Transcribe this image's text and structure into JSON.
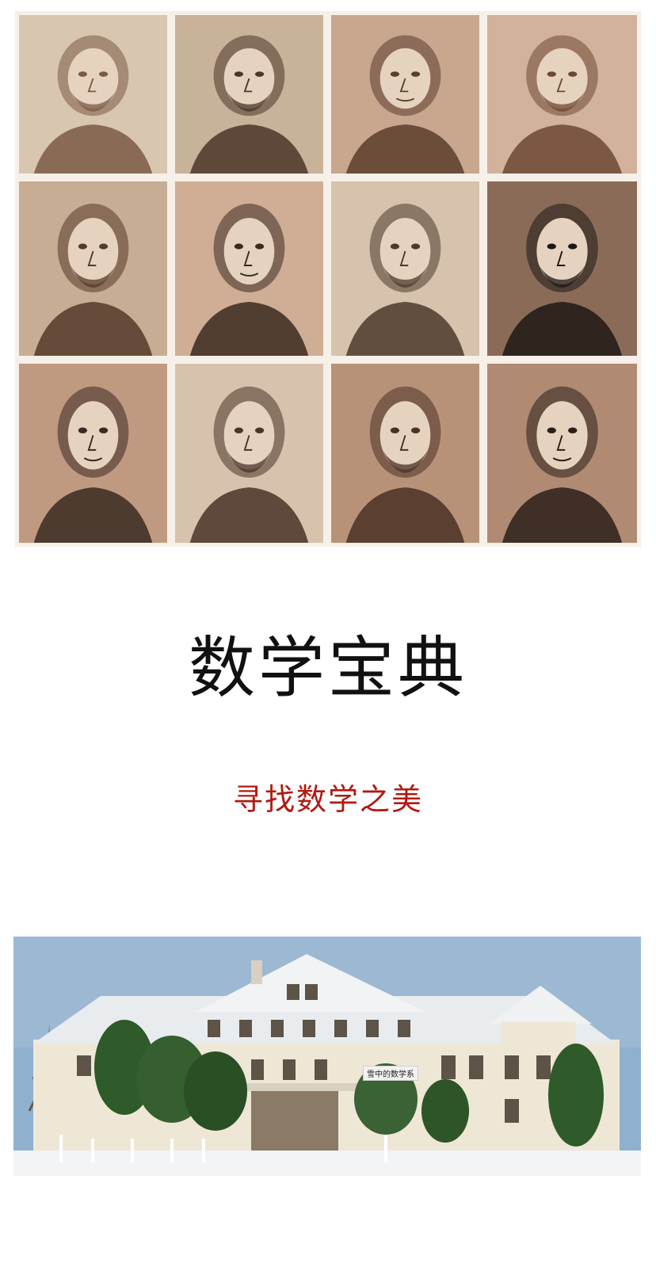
{
  "portraits": [
    {
      "name": "portrait-1",
      "tone": "#d9c6b0",
      "dark": "#7a5a45"
    },
    {
      "name": "portrait-2",
      "tone": "#c9b29a",
      "dark": "#4a3528"
    },
    {
      "name": "portrait-3",
      "tone": "#c8a78e",
      "dark": "#5b3d2c"
    },
    {
      "name": "portrait-4",
      "tone": "#d2b29a",
      "dark": "#6d4834"
    },
    {
      "name": "portrait-5",
      "tone": "#c7ad93",
      "dark": "#55392a"
    },
    {
      "name": "portrait-6",
      "tone": "#cfae95",
      "dark": "#3c2a20"
    },
    {
      "name": "portrait-7",
      "tone": "#d6c2ad",
      "dark": "#4d3a2c"
    },
    {
      "name": "portrait-8",
      "tone": "#8a6b57",
      "dark": "#1e1714"
    },
    {
      "name": "portrait-9",
      "tone": "#c09a80",
      "dark": "#3a2a22"
    },
    {
      "name": "portrait-10",
      "tone": "#d8c2ad",
      "dark": "#4b3428"
    },
    {
      "name": "portrait-11",
      "tone": "#b89278",
      "dark": "#4a3025"
    },
    {
      "name": "portrait-12",
      "tone": "#b08a72",
      "dark": "#2b1f19"
    }
  ],
  "title": "数学宝典",
  "subtitle": "寻找数学之美",
  "photo": {
    "caption": "雪中的数学系",
    "colors": {
      "sky": "#8fb0cf",
      "roof": "#e8ecef",
      "wall": "#efe7d6",
      "trees": "#2f5a2a",
      "snow": "#f2f4f6"
    }
  }
}
